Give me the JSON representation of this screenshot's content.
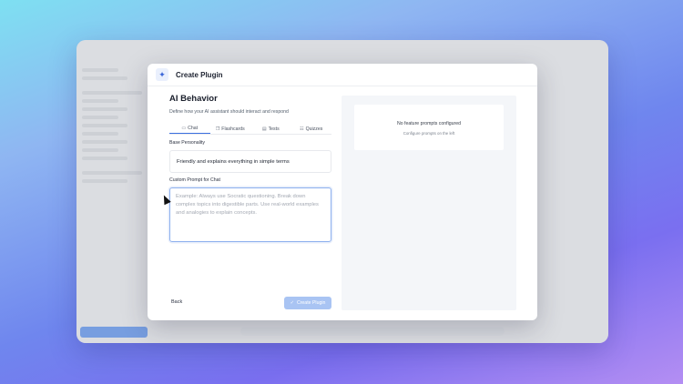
{
  "modal": {
    "title": "Create Plugin",
    "section_title": "AI Behavior",
    "section_subtitle": "Define how your AI assistant should interact and respond",
    "tabs": [
      {
        "label": "Chat",
        "icon": "chat-icon",
        "active": true
      },
      {
        "label": "Flashcards",
        "icon": "flashcards-icon",
        "active": false
      },
      {
        "label": "Tests",
        "icon": "tests-icon",
        "active": false
      },
      {
        "label": "Quizzes",
        "icon": "quizzes-icon",
        "active": false
      }
    ],
    "base_personality_label": "Base Personality",
    "base_personality_value": "Friendly and explains everything in simple terms",
    "custom_prompt_label": "Custom Prompt for Chat",
    "custom_prompt_placeholder": "Example: Always use Socratic questioning. Break down complex topics into digestible parts. Use real-world examples and analogies to explain concepts.",
    "back_label": "Back",
    "create_label": "Create Plugin"
  },
  "preview": {
    "title": "No feature prompts configured",
    "subtitle": "Configure prompts on the left"
  },
  "colors": {
    "accent": "#3b6fe0",
    "create_button_disabled": "#a9c4f3",
    "preview_bg": "#f4f6f9"
  }
}
